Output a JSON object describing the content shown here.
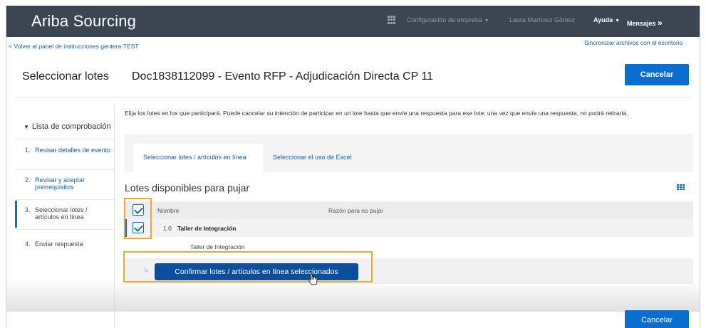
{
  "app": {
    "brand": "Ariba Sourcing"
  },
  "topnav": {
    "company_settings": "Configuración de empresa",
    "user": "Laura Martínez Gómez",
    "help": "Ayuda",
    "messages": "Mensajes",
    "messages_arrow": "»"
  },
  "subbar": {
    "back_link": "< Volver al panel de instrucciones gentera-TEST",
    "sync_link": "Sincronizar archivos con el escritorio"
  },
  "header": {
    "page_title": "Seleccionar lotes",
    "doc_title": "Doc1838112099 - Evento RFP - Adjudicación Directa CP 11",
    "cancel_label": "Cancelar"
  },
  "sidebar": {
    "checklist_label": "Lista de comprobación",
    "steps": [
      {
        "num": "1.",
        "label": "Revisar detalles de evento"
      },
      {
        "num": "2.",
        "label": "Revisar y aceptar prerrequisitos"
      },
      {
        "num": "3.",
        "label": "Seleccionar lotes / artículos en línea"
      },
      {
        "num": "4.",
        "label": "Enviar respuesta"
      }
    ]
  },
  "main": {
    "intro_text": "Elija los lotes en los que participará. Puede cancelar su intención de participar en un lote hasta que envíe una respuesta para ese lote; una vez que envíe una respuesta, no podrá retirarla.",
    "tabs": [
      {
        "label": "Seleccionar lotes / artículos en línea",
        "active": true
      },
      {
        "label": "Seleccionar el uso de Excel",
        "active": false
      }
    ],
    "section_title": "Lotes disponibles para pujar",
    "table": {
      "col_name": "Nombre",
      "col_reason": "Razón para no pujar",
      "lot_number": "1.0",
      "lot_name": "Taller de Integración",
      "item_name": "Taller de Integración"
    },
    "confirm_label": "Confirmar lotes / artículos en línea seleccionados",
    "cancel_bottom_label": "Cancelar"
  },
  "colors": {
    "topbar": "#3b4652",
    "accent": "#0a6ed1",
    "highlight": "#f0a830"
  }
}
